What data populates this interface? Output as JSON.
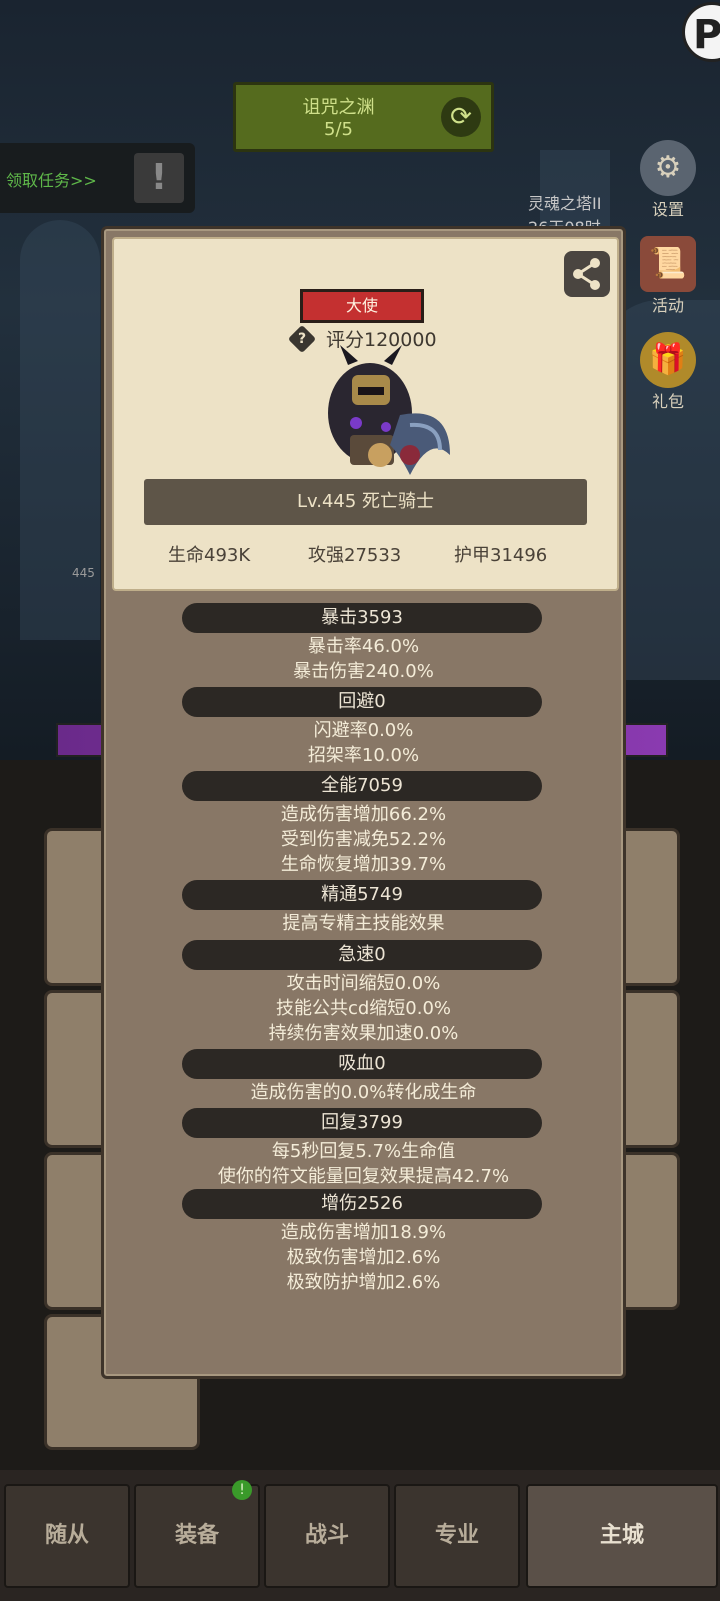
{
  "background": {
    "quest": {
      "title": "诅咒之渊",
      "progress": "5/5"
    },
    "task_link": "领取任务>>",
    "tower_label": "灵魂之塔II",
    "tower_timer": "26天08时",
    "side_menu": [
      {
        "label": "设置",
        "icon": "gear-icon"
      },
      {
        "label": "活动",
        "icon": "scroll-icon"
      },
      {
        "label": "礼包",
        "icon": "gift-icon"
      }
    ],
    "hero_level_small": "445"
  },
  "bottom_nav": {
    "tabs": [
      "随从",
      "装备",
      "战斗",
      "专业",
      "主城"
    ],
    "active": "主城",
    "badge": "!"
  },
  "panel": {
    "rank_badge": "大使",
    "help": "?",
    "score": "评分120000",
    "name": "Lv.445 死亡骑士",
    "main_stats": {
      "hp": "生命493K",
      "attack": "攻强27533",
      "armor": "护甲31496"
    },
    "groups": [
      {
        "title": "暴击3593",
        "lines": [
          "暴击率46.0%",
          "暴击伤害240.0%"
        ]
      },
      {
        "title": "回避0",
        "lines": [
          "闪避率0.0%",
          "招架率10.0%"
        ]
      },
      {
        "title": "全能7059",
        "lines": [
          "造成伤害增加66.2%",
          "受到伤害减免52.2%",
          "生命恢复增加39.7%"
        ]
      },
      {
        "title": "精通5749",
        "lines": [
          "提高专精主技能效果"
        ]
      },
      {
        "title": "急速0",
        "lines": [
          "攻击时间缩短0.0%",
          "技能公共cd缩短0.0%",
          "持续伤害效果加速0.0%"
        ]
      },
      {
        "title": "吸血0",
        "lines": [
          "造成伤害的0.0%转化成生命"
        ]
      },
      {
        "title": "回复3799",
        "lines": [
          "每5秒回复5.7%生命值",
          "使你的符文能量回复效果提高42.7%"
        ]
      },
      {
        "title": "增伤2526",
        "lines": [
          "造成伤害增加18.9%",
          "极致伤害增加2.6%",
          "极致防护增加2.6%"
        ]
      }
    ]
  }
}
